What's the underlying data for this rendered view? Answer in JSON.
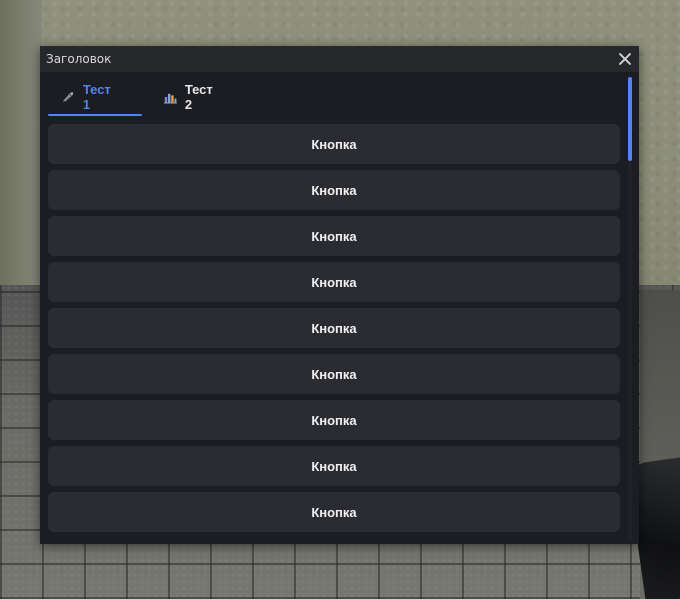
{
  "window": {
    "title": "Заголовок"
  },
  "tabs": [
    {
      "label": "Тест 1",
      "icon": "rocket-icon",
      "active": true
    },
    {
      "label": "Тест 2",
      "icon": "chart-icon",
      "active": false
    }
  ],
  "buttons": [
    {
      "label": "Кнопка"
    },
    {
      "label": "Кнопка"
    },
    {
      "label": "Кнопка"
    },
    {
      "label": "Кнопка"
    },
    {
      "label": "Кнопка"
    },
    {
      "label": "Кнопка"
    },
    {
      "label": "Кнопка"
    },
    {
      "label": "Кнопка"
    },
    {
      "label": "Кнопка"
    }
  ],
  "colors": {
    "accent": "#4f86f0",
    "window_bg": "#1c1d22",
    "titlebar_bg": "#27282c",
    "button_bg": "#2b2c32"
  }
}
